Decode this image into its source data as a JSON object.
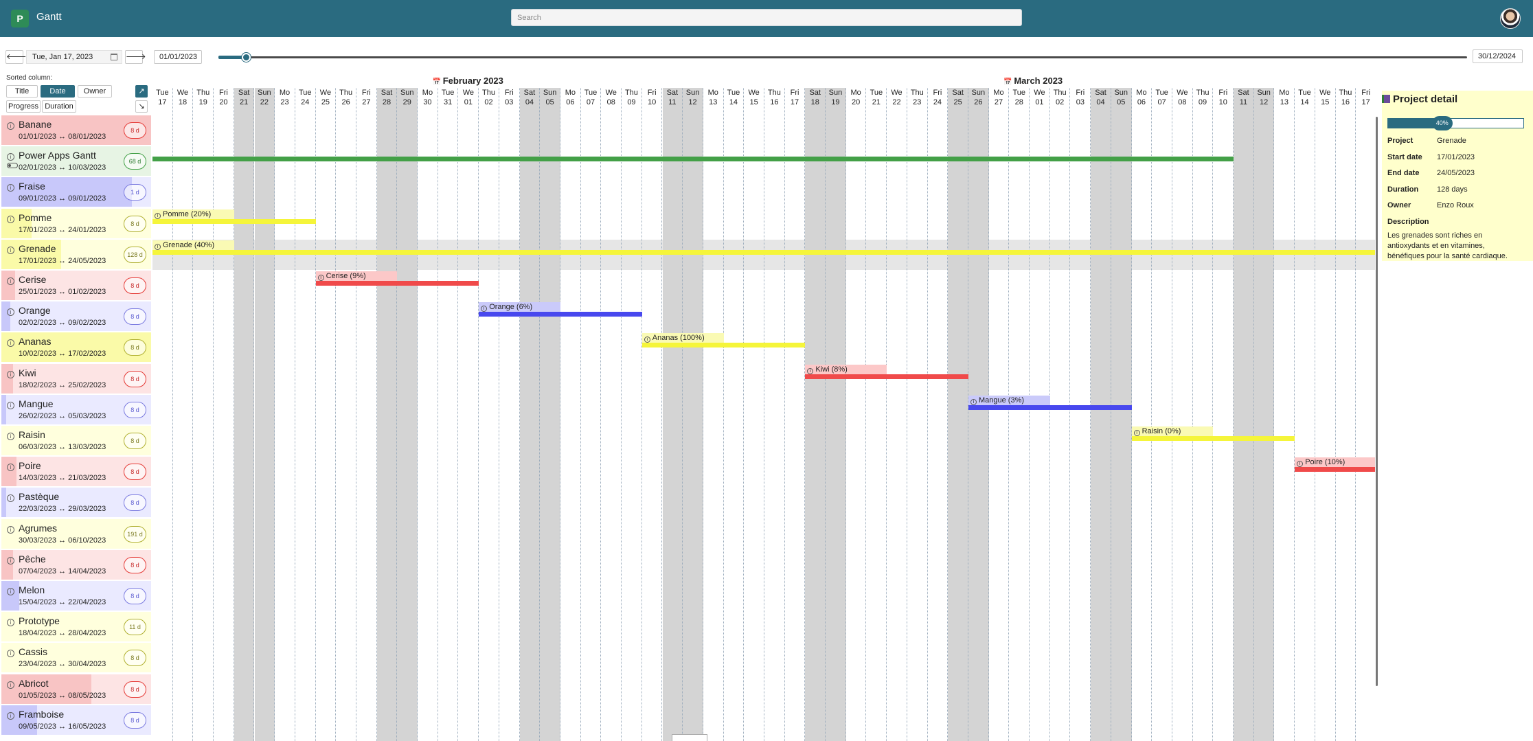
{
  "app": {
    "title": "Gantt",
    "logo": "P"
  },
  "search": {
    "placeholder": "Search"
  },
  "toolbar": {
    "prev_icon": "arrow-left-icon",
    "next_icon": "arrow-right-icon",
    "current_date": "Tue, Jan 17, 2023",
    "range_start": "01/01/2023",
    "range_end": "30/12/2024",
    "range_position": 0.019
  },
  "sorting": {
    "label": "Sorted column:",
    "buttons": [
      "Title",
      "Date",
      "Owner",
      "Progress",
      "Duration"
    ],
    "active": "Date",
    "expand_icon": "arrow-up-right-icon",
    "collapse_icon": "arrow-down-right-icon"
  },
  "tasks": [
    {
      "name": "Banane",
      "dates": "01/01/2023 ↔ 08/01/2023",
      "duration": "8 d",
      "color": "red",
      "progress": 1.0
    },
    {
      "name": "Power Apps Gantt",
      "dates": "02/01/2023 ↔ 10/03/2023",
      "duration": "68 d",
      "color": "green",
      "progress": 0.0,
      "project": true
    },
    {
      "name": "Fraise",
      "dates": "09/01/2023 ↔ 09/01/2023",
      "duration": "1 d",
      "color": "blue",
      "progress": 0.87
    },
    {
      "name": "Pomme",
      "dates": "17/01/2023 ↔ 24/01/2023",
      "duration": "8 d",
      "color": "yellow",
      "progress": 0.2
    },
    {
      "name": "Grenade",
      "dates": "17/01/2023 ↔ 24/05/2023",
      "duration": "128 d",
      "color": "yellow",
      "progress": 0.4
    },
    {
      "name": "Cerise",
      "dates": "25/01/2023 ↔ 01/02/2023",
      "duration": "8 d",
      "color": "red",
      "progress": 0.09
    },
    {
      "name": "Orange",
      "dates": "02/02/2023 ↔ 09/02/2023",
      "duration": "8 d",
      "color": "blue",
      "progress": 0.06
    },
    {
      "name": "Ananas",
      "dates": "10/02/2023 ↔ 17/02/2023",
      "duration": "8 d",
      "color": "yellow",
      "progress": 1.0
    },
    {
      "name": "Kiwi",
      "dates": "18/02/2023 ↔ 25/02/2023",
      "duration": "8 d",
      "color": "red",
      "progress": 0.08
    },
    {
      "name": "Mangue",
      "dates": "26/02/2023 ↔ 05/03/2023",
      "duration": "8 d",
      "color": "blue",
      "progress": 0.03
    },
    {
      "name": "Raisin",
      "dates": "06/03/2023 ↔ 13/03/2023",
      "duration": "8 d",
      "color": "yellow",
      "progress": 0.0
    },
    {
      "name": "Poire",
      "dates": "14/03/2023 ↔ 21/03/2023",
      "duration": "8 d",
      "color": "red",
      "progress": 0.1
    },
    {
      "name": "Pastèque",
      "dates": "22/03/2023 ↔ 29/03/2023",
      "duration": "8 d",
      "color": "blue",
      "progress": 0.03
    },
    {
      "name": "Agrumes",
      "dates": "30/03/2023 ↔ 06/10/2023",
      "duration": "191 d",
      "color": "yellow",
      "progress": 0.0
    },
    {
      "name": "Pêche",
      "dates": "07/04/2023 ↔ 14/04/2023",
      "duration": "8 d",
      "color": "red",
      "progress": 0.08
    },
    {
      "name": "Melon",
      "dates": "15/04/2023 ↔ 22/04/2023",
      "duration": "8 d",
      "color": "blue",
      "progress": 0.12
    },
    {
      "name": "Prototype",
      "dates": "18/04/2023 ↔ 28/04/2023",
      "duration": "11 d",
      "color": "yellow",
      "progress": 0.0
    },
    {
      "name": "Cassis",
      "dates": "23/04/2023 ↔ 30/04/2023",
      "duration": "8 d",
      "color": "yellow",
      "progress": 0.0
    },
    {
      "name": "Abricot",
      "dates": "01/05/2023 ↔ 08/05/2023",
      "duration": "8 d",
      "color": "red",
      "progress": 0.6
    },
    {
      "name": "Framboise",
      "dates": "09/05/2023 ↔ 16/05/2023",
      "duration": "8 d",
      "color": "blue",
      "progress": 0.24
    }
  ],
  "timeline": {
    "months": [
      {
        "label": "February 2023",
        "icon": "calendar-icon",
        "day_index": 15
      },
      {
        "label": "March 2023",
        "icon": "calendar-icon",
        "day_index": 43
      }
    ],
    "days": [
      [
        "Tue",
        "17"
      ],
      [
        "We",
        "18"
      ],
      [
        "Thu",
        "19"
      ],
      [
        "Fri",
        "20"
      ],
      [
        "Sat",
        "21"
      ],
      [
        "Sun",
        "22"
      ],
      [
        "Mo",
        "23"
      ],
      [
        "Tue",
        "24"
      ],
      [
        "We",
        "25"
      ],
      [
        "Thu",
        "26"
      ],
      [
        "Fri",
        "27"
      ],
      [
        "Sat",
        "28"
      ],
      [
        "Sun",
        "29"
      ],
      [
        "Mo",
        "30"
      ],
      [
        "Tue",
        "31"
      ],
      [
        "We",
        "01"
      ],
      [
        "Thu",
        "02"
      ],
      [
        "Fri",
        "03"
      ],
      [
        "Sat",
        "04"
      ],
      [
        "Sun",
        "05"
      ],
      [
        "Mo",
        "06"
      ],
      [
        "Tue",
        "07"
      ],
      [
        "We",
        "08"
      ],
      [
        "Thu",
        "09"
      ],
      [
        "Fri",
        "10"
      ],
      [
        "Sat",
        "11"
      ],
      [
        "Sun",
        "12"
      ],
      [
        "Mo",
        "13"
      ],
      [
        "Tue",
        "14"
      ],
      [
        "We",
        "15"
      ],
      [
        "Thu",
        "16"
      ],
      [
        "Fri",
        "17"
      ],
      [
        "Sat",
        "18"
      ],
      [
        "Sun",
        "19"
      ],
      [
        "Mo",
        "20"
      ],
      [
        "Tue",
        "21"
      ],
      [
        "We",
        "22"
      ],
      [
        "Thu",
        "23"
      ],
      [
        "Fri",
        "24"
      ],
      [
        "Sat",
        "25"
      ],
      [
        "Sun",
        "26"
      ],
      [
        "Mo",
        "27"
      ],
      [
        "Tue",
        "28"
      ],
      [
        "We",
        "01"
      ],
      [
        "Thu",
        "02"
      ],
      [
        "Fri",
        "03"
      ],
      [
        "Sat",
        "04"
      ],
      [
        "Sun",
        "05"
      ],
      [
        "Mo",
        "06"
      ],
      [
        "Tue",
        "07"
      ],
      [
        "We",
        "08"
      ],
      [
        "Thu",
        "09"
      ],
      [
        "Fri",
        "10"
      ],
      [
        "Sat",
        "11"
      ],
      [
        "Sun",
        "12"
      ],
      [
        "Mo",
        "13"
      ],
      [
        "Tue",
        "14"
      ],
      [
        "We",
        "15"
      ],
      [
        "Thu",
        "16"
      ],
      [
        "Fri",
        "17"
      ]
    ],
    "bars": [
      {
        "row": 1,
        "start": 0,
        "end": 53,
        "color": "green",
        "label": ""
      },
      {
        "row": 3,
        "start": 0,
        "end": 8,
        "color": "yellow",
        "label": "Pomme (20%)"
      },
      {
        "row": 4,
        "start": 0,
        "end": 60,
        "color": "yellow",
        "label": "Grenade (40%)"
      },
      {
        "row": 5,
        "start": 8,
        "end": 16,
        "color": "red",
        "label": "Cerise (9%)"
      },
      {
        "row": 6,
        "start": 16,
        "end": 24,
        "color": "blue",
        "label": "Orange (6%)"
      },
      {
        "row": 7,
        "start": 24,
        "end": 32,
        "color": "yellow",
        "label": "Ananas (100%)"
      },
      {
        "row": 8,
        "start": 32,
        "end": 40,
        "color": "red",
        "label": "Kiwi (8%)"
      },
      {
        "row": 9,
        "start": 40,
        "end": 48,
        "color": "blue",
        "label": "Mangue (3%)"
      },
      {
        "row": 10,
        "start": 48,
        "end": 56,
        "color": "yellow",
        "label": "Raisin (0%)"
      },
      {
        "row": 11,
        "start": 56,
        "end": 60,
        "color": "red",
        "label": "Poire (10%)"
      }
    ],
    "selected_row": 4
  },
  "detail": {
    "title": "Project detail",
    "title_icon": "books-icon",
    "progress": 0.4,
    "progress_label": "40%",
    "fields": [
      {
        "key": "Project",
        "value": "Grenade"
      },
      {
        "key": "Start date",
        "value": "17/01/2023"
      },
      {
        "key": "End date",
        "value": "24/05/2023"
      },
      {
        "key": "Duration",
        "value": "128 days"
      },
      {
        "key": "Owner",
        "value": "Enzo Roux"
      }
    ],
    "description_label": "Description",
    "description": "Les grenades sont riches en antioxydants et en vitamines, bénéfiques pour la santé cardiaque."
  },
  "palette": {
    "red": {
      "bg": "#fde4e4",
      "prog": "#f8c4c4",
      "bar": "#f04a4a",
      "label": "#fcc8c8",
      "border": "#e53935",
      "text": "#c62828"
    },
    "green": {
      "bg": "#e7f4e4",
      "prog": "#c8e6c9",
      "bar": "#43a047",
      "label": "#c8e6c9",
      "border": "#43a047",
      "text": "#2e7d32"
    },
    "blue": {
      "bg": "#eaeaff",
      "prog": "#c8c8fa",
      "bar": "#4848ee",
      "label": "#cacafa",
      "border": "#7b7be0",
      "text": "#5a5ad0"
    },
    "yellow": {
      "bg": "#ffffdd",
      "prog": "#fafaa8",
      "bar": "#f5f53a",
      "label": "#fafab4",
      "border": "#b0b030",
      "text": "#7a7a20"
    },
    "accent": "#2a6b80"
  }
}
